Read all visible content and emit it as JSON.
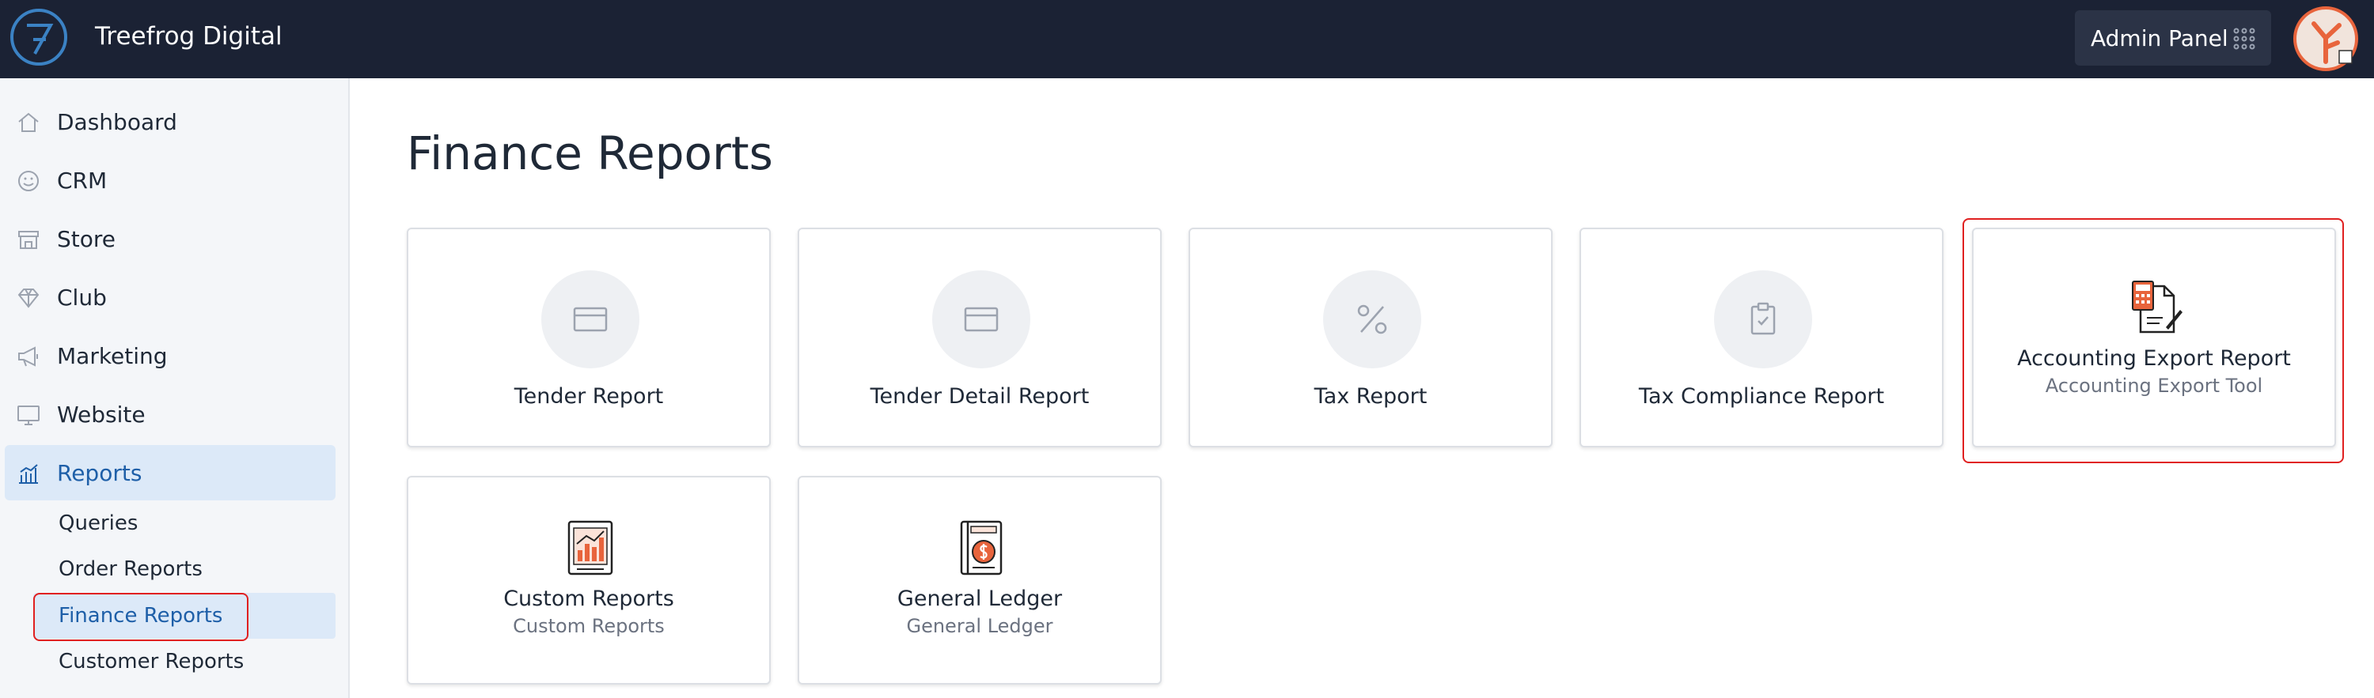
{
  "header": {
    "brand": "Treefrog Digital",
    "admin_label": "Admin Panel"
  },
  "sidebar": {
    "items": [
      {
        "label": "Dashboard",
        "icon": "home-icon"
      },
      {
        "label": "CRM",
        "icon": "smiley-icon"
      },
      {
        "label": "Store",
        "icon": "store-icon"
      },
      {
        "label": "Club",
        "icon": "diamond-icon"
      },
      {
        "label": "Marketing",
        "icon": "megaphone-icon"
      },
      {
        "label": "Website",
        "icon": "monitor-icon"
      },
      {
        "label": "Reports",
        "icon": "bar-chart-icon",
        "active": true
      }
    ],
    "subitems": [
      {
        "label": "Queries"
      },
      {
        "label": "Order Reports"
      },
      {
        "label": "Finance Reports",
        "active": true
      },
      {
        "label": "Customer Reports"
      }
    ]
  },
  "main": {
    "title": "Finance Reports",
    "cards": [
      {
        "title": "Tender Report",
        "icon": "credit-card-icon"
      },
      {
        "title": "Tender Detail Report",
        "icon": "credit-card-icon"
      },
      {
        "title": "Tax Report",
        "icon": "percent-icon"
      },
      {
        "title": "Tax Compliance Report",
        "icon": "clipboard-check-icon"
      },
      {
        "title": "Accounting Export Report",
        "subtitle": "Accounting Export Tool",
        "icon": "accounting-document-icon"
      },
      {
        "title": "Custom Reports",
        "subtitle": "Custom Reports",
        "icon": "chart-document-icon"
      },
      {
        "title": "General Ledger",
        "subtitle": "General Ledger",
        "icon": "ledger-book-icon"
      }
    ]
  },
  "colors": {
    "topbar": "#1b2234",
    "accent": "#1e5fa8",
    "active_bg": "#dce9f8",
    "highlight": "#e02020",
    "icon_orange": "#e8643c"
  }
}
